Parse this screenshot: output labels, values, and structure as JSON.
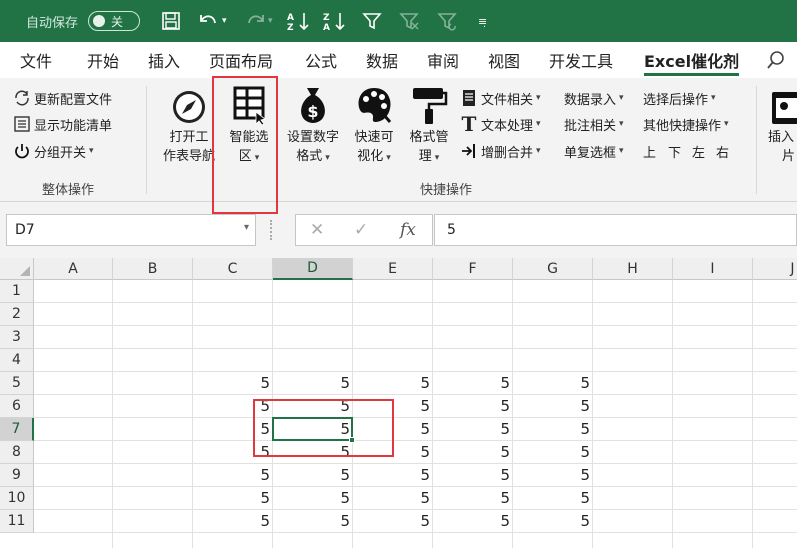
{
  "titlebar": {
    "autosave_label": "自动保存",
    "autosave_state": "关",
    "icons": [
      "save-icon",
      "undo-icon",
      "redo-icon",
      "sort-ascending-icon",
      "sort-descending-icon",
      "filter-icon",
      "clear-filter-icon",
      "reapply-filter-icon",
      "customize-toolbar-icon"
    ]
  },
  "tabs": [
    "文件",
    "开始",
    "插入",
    "页面布局",
    "公式",
    "数据",
    "审阅",
    "视图",
    "开发工具",
    "Excel催化剂"
  ],
  "active_tab": "Excel催化剂",
  "ribbon": {
    "group1": {
      "items": [
        "更新配置文件",
        "显示功能清单",
        "分组开关"
      ],
      "label": "整体操作"
    },
    "group2": {
      "big_buttons": [
        {
          "line1": "打开工",
          "line2": "作表导航"
        },
        {
          "line1": "智能选",
          "line2": "区"
        },
        {
          "line1": "设置数字",
          "line2": "格式"
        },
        {
          "line1": "快速可",
          "line2": "视化"
        },
        {
          "line1": "格式管",
          "line2": "理"
        }
      ],
      "col1": [
        "文件相关",
        "文本处理",
        "增删合并"
      ],
      "col2": [
        "数据录入",
        "批注相关",
        "单复选框"
      ],
      "col3": [
        "选择后操作",
        "其他快捷操作"
      ],
      "nav": [
        "上",
        "下",
        "左",
        "右"
      ],
      "label": "快捷操作"
    },
    "group3": {
      "line1": "插入",
      "line2": "片"
    }
  },
  "formula_bar": {
    "name_box": "D7",
    "value": "5"
  },
  "grid": {
    "columns": [
      "A",
      "B",
      "C",
      "D",
      "E",
      "F",
      "G",
      "H",
      "I",
      "J"
    ],
    "rows": [
      "1",
      "2",
      "3",
      "4",
      "5",
      "6",
      "7",
      "8",
      "9",
      "10",
      "11"
    ],
    "selected_column": "D",
    "selected_row": "7",
    "data_start_row": 5,
    "data_columns": [
      "C",
      "D",
      "E",
      "F",
      "G"
    ],
    "cell_value": "5"
  },
  "colors": {
    "brand": "#217346",
    "highlight": "#e0383e"
  }
}
